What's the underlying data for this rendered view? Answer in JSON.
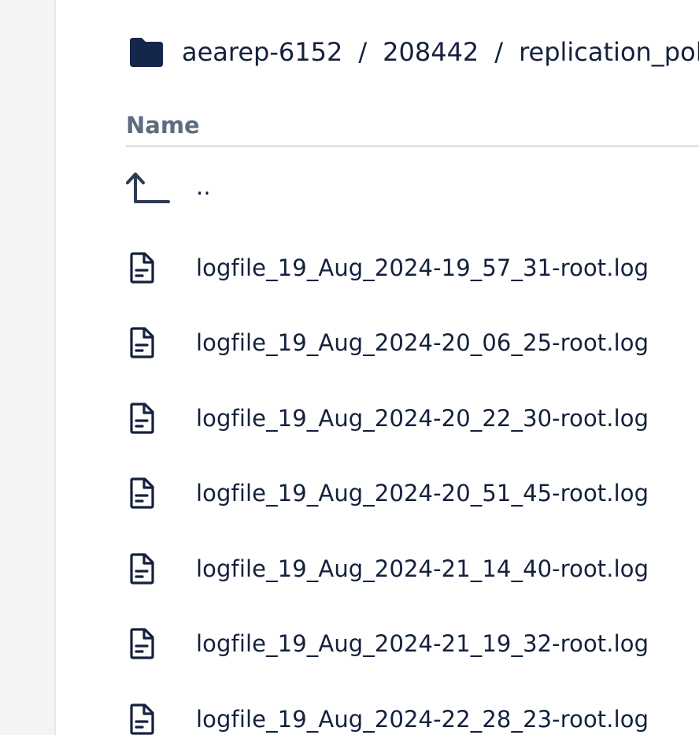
{
  "breadcrumb": {
    "items": [
      "aearep-6152",
      "208442",
      "replication_policies"
    ],
    "separator": "/"
  },
  "table": {
    "column_name": "Name",
    "parent_label": "..",
    "files": [
      "logfile_19_Aug_2024-19_57_31-root.log",
      "logfile_19_Aug_2024-20_06_25-root.log",
      "logfile_19_Aug_2024-20_22_30-root.log",
      "logfile_19_Aug_2024-20_51_45-root.log",
      "logfile_19_Aug_2024-21_14_40-root.log",
      "logfile_19_Aug_2024-21_19_32-root.log",
      "logfile_19_Aug_2024-22_28_23-root.log"
    ]
  },
  "icons": {
    "folder": "folder-icon",
    "parent": "arrow-up-left-icon",
    "file": "file-document-icon"
  },
  "colors": {
    "text": "#14213d",
    "header_text": "#5f6b80",
    "divider": "#e2e4e8",
    "gutter": "#f3f4f6"
  }
}
